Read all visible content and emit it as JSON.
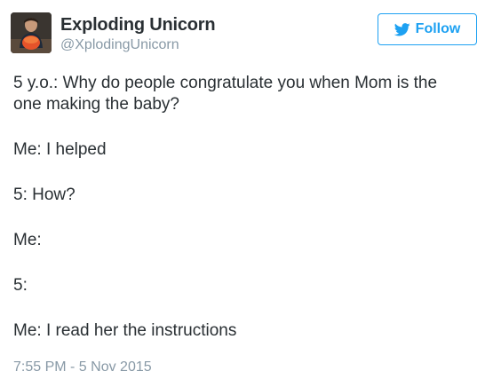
{
  "author": {
    "display_name": "Exploding Unicorn",
    "handle": "@XplodingUnicorn",
    "avatar_icon": "profile-photo"
  },
  "follow_button": {
    "label": "Follow",
    "icon": "twitter-bird-icon",
    "color": "#1da1f2"
  },
  "tweet": {
    "paragraphs": [
      "5 y.o.: Why do people congratulate you when Mom is the one making the baby?",
      "Me: I helped",
      "5: How?",
      "Me:",
      "5:",
      "Me: I read her the instructions"
    ],
    "timestamp": "7:55 PM - 5 Nov 2015"
  }
}
